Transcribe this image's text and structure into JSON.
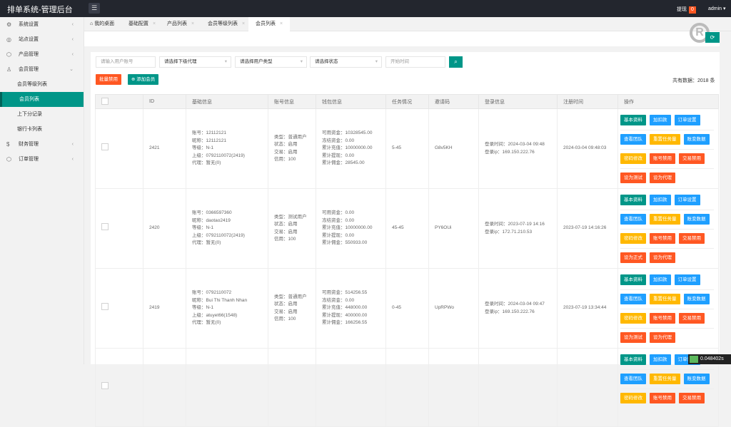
{
  "header": {
    "title": "排单系统-管理后台",
    "withdraw_label": "提现",
    "withdraw_count": "0",
    "user": "admin"
  },
  "sidebar": {
    "items": [
      {
        "label": "系统设置",
        "icon": "gear-icon",
        "glyph": "⚙",
        "chevron": "‹"
      },
      {
        "label": "站点设置",
        "icon": "site-icon",
        "glyph": "◎",
        "chevron": "‹"
      },
      {
        "label": "产品管理",
        "icon": "product-icon",
        "glyph": "⬡",
        "chevron": "‹"
      },
      {
        "label": "会员管理",
        "icon": "user-icon",
        "glyph": "♙",
        "chevron": "⌄"
      },
      {
        "label": "会员等级列表",
        "sub": true
      },
      {
        "label": "会员列表",
        "sub": true,
        "active": true
      },
      {
        "label": "上下分记录",
        "sub": true
      },
      {
        "label": "银行卡列表",
        "sub": true
      },
      {
        "label": "财务管理",
        "icon": "dollar-icon",
        "glyph": "$",
        "chevron": "‹"
      },
      {
        "label": "订单管理",
        "icon": "order-icon",
        "glyph": "⬡",
        "chevron": "‹"
      }
    ]
  },
  "tabs": [
    {
      "label": "我的桌面"
    },
    {
      "label": "基础配置"
    },
    {
      "label": "产品列表"
    },
    {
      "label": "会员等级列表"
    },
    {
      "label": "会员列表"
    }
  ],
  "filters": {
    "account_placeholder": "请输入用户账号",
    "agent": "请选择下级代理",
    "type": "请选择用户类型",
    "status": "请选择状态",
    "start_placeholder": "开始时间"
  },
  "toolbar": {
    "batch_disable": "批量禁用",
    "add_member": "添加会员",
    "total": "共有数据：2018 条"
  },
  "columns": [
    "",
    "ID",
    "基础信息",
    "账号信息",
    "钱包信息",
    "任务情况",
    "邀请码",
    "登录信息",
    "注册时间",
    "操作"
  ],
  "rows": [
    {
      "id": "2421",
      "basic": [
        "账号：12112121",
        "昵称：12112121",
        "等级：N-1",
        "上级：0792110072(2419)",
        "代理：暂无(0)"
      ],
      "account": [
        "类型：普通用户",
        "状态：启用",
        "交易：启用",
        "信用：100"
      ],
      "wallet": [
        "可用资金：10328545.00",
        "冻结资金：0.00",
        "累计充值：10000000.00",
        "累计提现：0.00",
        "累计佣金：28545.00"
      ],
      "task": "5-45",
      "invite": "G8v5KH",
      "login": [
        "登录时间：2024-03-04 09:48",
        "登录ip：169.150.222.76"
      ],
      "reg": "2024-03-04 09:48:03",
      "last_ops": [
        "设为测试",
        "设为代理"
      ]
    },
    {
      "id": "2420",
      "basic": [
        "账号：0366597360",
        "昵称：daotao2419",
        "等级：N-1",
        "上级：0792110072(2419)",
        "代理：暂无(0)"
      ],
      "account": [
        "类型：测试用户",
        "状态：启用",
        "交易：启用",
        "信用：100"
      ],
      "wallet": [
        "可用资金：0.00",
        "冻结资金：0.00",
        "累计充值：10000000.00",
        "累计提现：0.00",
        "累计佣金：550933.00"
      ],
      "task": "45-45",
      "invite": "PY6OUi",
      "login": [
        "登录时间：2023-07-19 14:16",
        "登录ip：172.71.210.53"
      ],
      "reg": "2023-07-19 14:16:26",
      "last_ops": [
        "设为正式",
        "设为代理"
      ]
    },
    {
      "id": "2419",
      "basic": [
        "账号：0792110072",
        "昵称：Bui Thi Thanh Nhan",
        "等级：N-1",
        "上级：atuyet66(1548)",
        "代理：暂无(0)"
      ],
      "account": [
        "类型：普通用户",
        "状态：启用",
        "交易：启用",
        "信用：100"
      ],
      "wallet": [
        "可用资金：514256.55",
        "冻结资金：0.00",
        "累计充值：448000.00",
        "累计提现：400000.00",
        "累计佣金：166256.55"
      ],
      "task": "0-45",
      "invite": "UpRPWo",
      "login": [
        "登录时间：2024-03-04 09:47",
        "登录ip：169.150.222.76"
      ],
      "reg": "2023-07-19 13:34:44",
      "last_ops": [
        "设为测试",
        "设为代理"
      ]
    },
    {
      "id": "",
      "basic": [],
      "account": [],
      "wallet": [],
      "task": "",
      "invite": "",
      "login": [],
      "reg": "",
      "last_ops": []
    }
  ],
  "ops": [
    [
      "基本资料",
      "加扣款",
      "订单设置"
    ],
    [
      "查看团队",
      "重置任务量",
      "账变数据"
    ],
    [
      "密码修改",
      "账号禁用",
      "交易禁用"
    ]
  ],
  "colors": {
    "green": "#009688",
    "blue": "#1e9fff",
    "orange": "#ffb800",
    "red": "#ff5722"
  },
  "timer": "0.048402s"
}
